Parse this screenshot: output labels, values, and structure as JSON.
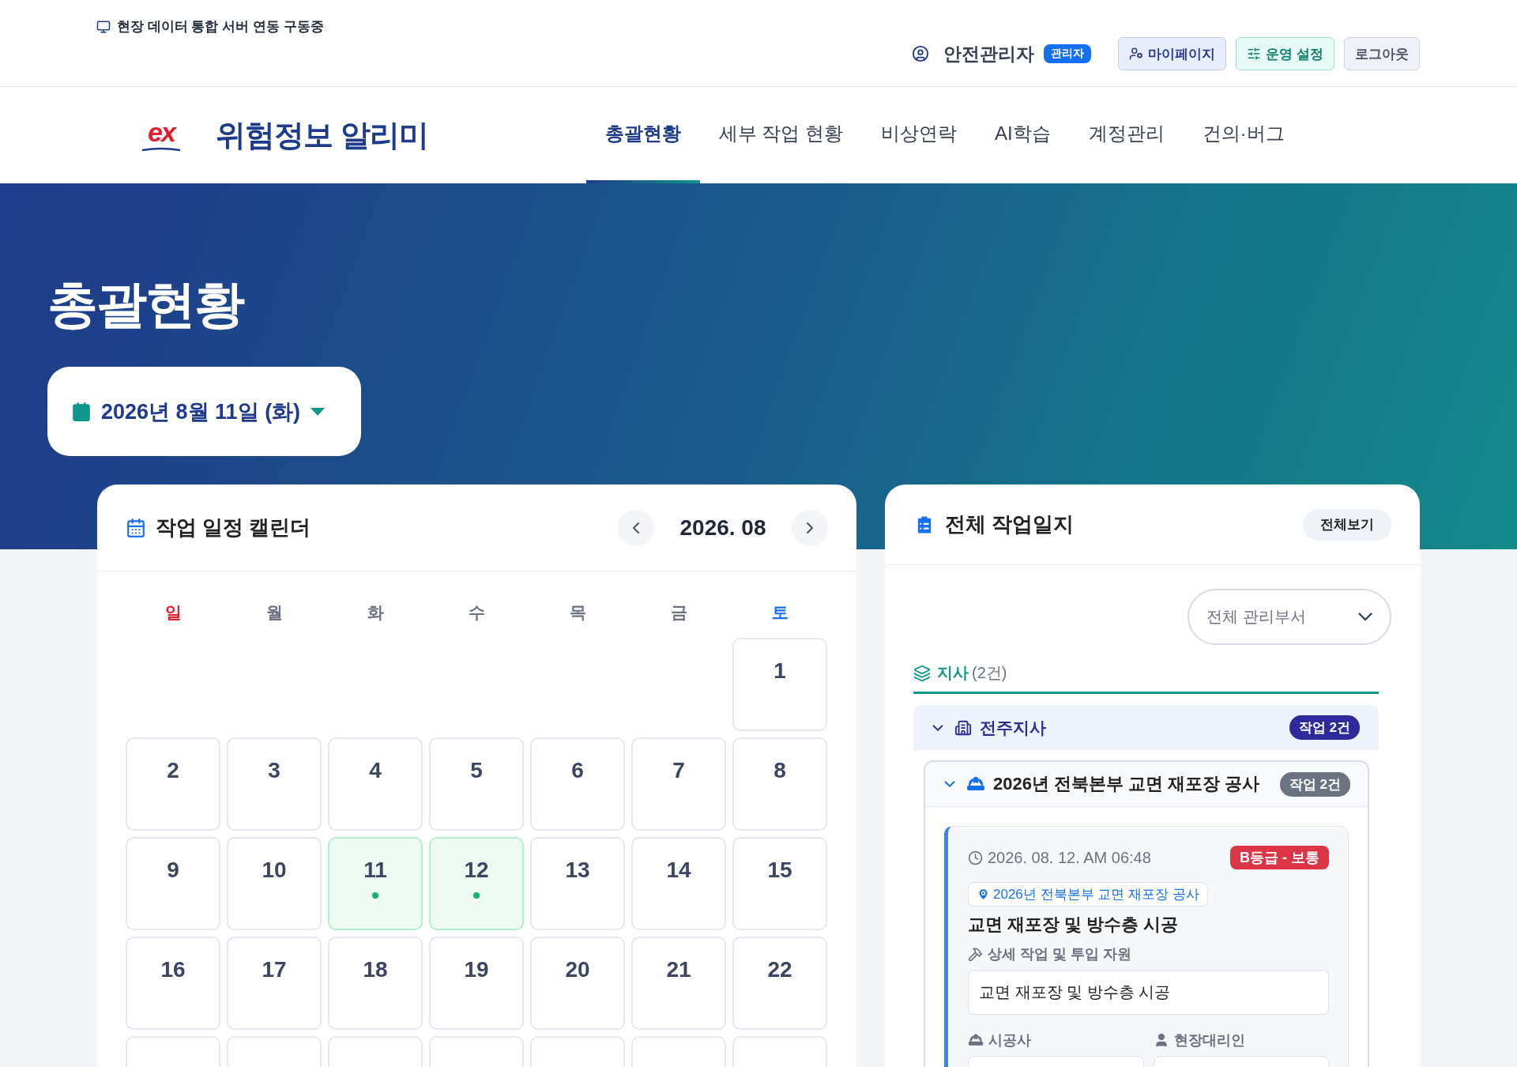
{
  "status_bar": {
    "text": "현장 데이터 통합 서버 연동 구동중"
  },
  "user": {
    "name": "안전관리자",
    "role_badge": "관리자"
  },
  "header_buttons": [
    {
      "label": "마이페이지",
      "kind": "mypage"
    },
    {
      "label": "운영 설정",
      "kind": "settings"
    },
    {
      "label": "로그아웃",
      "kind": "logout"
    }
  ],
  "brand": {
    "logo": "ex",
    "title": "위험정보 알리미"
  },
  "nav": [
    {
      "label": "총괄현황",
      "selected": true
    },
    {
      "label": "세부 작업 현황",
      "selected": false
    },
    {
      "label": "비상연락",
      "selected": false
    },
    {
      "label": "AI학습",
      "selected": false
    },
    {
      "label": "계정관리",
      "selected": false
    },
    {
      "label": "건의·버그",
      "selected": false
    }
  ],
  "page_title": "총괄현황",
  "date_picker": {
    "value": "2026년 8월 11일 (화)"
  },
  "calendar": {
    "title": "작업 일정 캘린더",
    "month": "2026. 08",
    "weekdays": [
      {
        "label": "일",
        "kind": "sunday"
      },
      {
        "label": "월",
        "kind": "weekday"
      },
      {
        "label": "화",
        "kind": "weekday"
      },
      {
        "label": "수",
        "kind": "weekday"
      },
      {
        "label": "목",
        "kind": "weekday"
      },
      {
        "label": "금",
        "kind": "weekday"
      },
      {
        "label": "토",
        "kind": "saturday"
      }
    ],
    "weeks": [
      [
        {
          "kind": "empty"
        },
        {
          "kind": "empty"
        },
        {
          "kind": "empty"
        },
        {
          "kind": "empty"
        },
        {
          "kind": "empty"
        },
        {
          "kind": "empty"
        },
        {
          "kind": "day",
          "day": "1",
          "has_work": false
        }
      ],
      [
        {
          "kind": "day",
          "day": "2",
          "has_work": false
        },
        {
          "kind": "day",
          "day": "3",
          "has_work": false
        },
        {
          "kind": "day",
          "day": "4",
          "has_work": false
        },
        {
          "kind": "day",
          "day": "5",
          "has_work": false
        },
        {
          "kind": "day",
          "day": "6",
          "has_work": false
        },
        {
          "kind": "day",
          "day": "7",
          "has_work": false
        },
        {
          "kind": "day",
          "day": "8",
          "has_work": false
        }
      ],
      [
        {
          "kind": "day",
          "day": "9",
          "has_work": false
        },
        {
          "kind": "day",
          "day": "10",
          "has_work": false
        },
        {
          "kind": "day",
          "day": "11",
          "has_work": true
        },
        {
          "kind": "day",
          "day": "12",
          "has_work": true
        },
        {
          "kind": "day",
          "day": "13",
          "has_work": false
        },
        {
          "kind": "day",
          "day": "14",
          "has_work": false
        },
        {
          "kind": "day",
          "day": "15",
          "has_work": false
        }
      ],
      [
        {
          "kind": "day",
          "day": "16",
          "has_work": false
        },
        {
          "kind": "day",
          "day": "17",
          "has_work": false
        },
        {
          "kind": "day",
          "day": "18",
          "has_work": false
        },
        {
          "kind": "day",
          "day": "19",
          "has_work": false
        },
        {
          "kind": "day",
          "day": "20",
          "has_work": false
        },
        {
          "kind": "day",
          "day": "21",
          "has_work": false
        },
        {
          "kind": "day",
          "day": "22",
          "has_work": false
        }
      ],
      [
        {
          "kind": "cut"
        },
        {
          "kind": "cut"
        },
        {
          "kind": "cut"
        },
        {
          "kind": "cut"
        },
        {
          "kind": "cut"
        },
        {
          "kind": "cut"
        },
        {
          "kind": "cut"
        }
      ]
    ]
  },
  "work_log": {
    "title": "전체 작업일지",
    "view_all": "전체보기",
    "department_select": {
      "value": "전체 관리부서"
    },
    "section": {
      "label": "지사",
      "count": "(2건)"
    },
    "branches": [
      {
        "name": "전주지사",
        "badge": "작업 2건",
        "expanded": true,
        "projects": [
          {
            "name": "2026년 전북본부 교면 재포장 공사",
            "badge": "작업 2건",
            "expanded": true,
            "logs": [
              {
                "time": "2026. 08. 12. AM 06:48",
                "grade": "B등급 - 보통",
                "color": "#dc3545",
                "location": "2026년 전북본부 교면 재포장 공사",
                "title": "교면 재포장 및 방수층 시공",
                "detail_label": "상세 작업 및 투입 자원",
                "detail": "교면 재포장 및 방수층 시공",
                "fields": [
                  {
                    "label": "시공사",
                    "kind": "contractor"
                  },
                  {
                    "label": "현장대리인",
                    "kind": "agent"
                  }
                ]
              }
            ]
          }
        ]
      }
    ]
  }
}
